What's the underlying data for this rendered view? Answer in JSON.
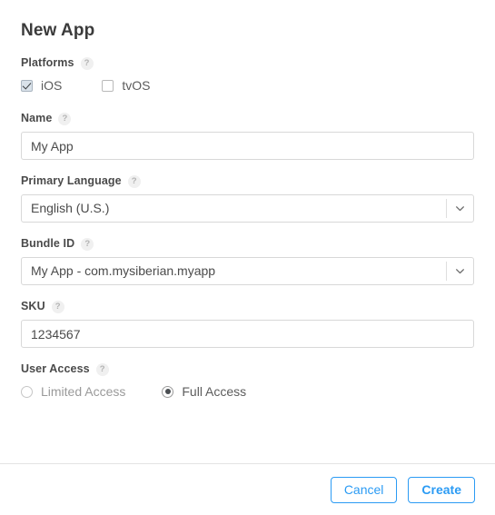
{
  "dialog": {
    "title": "New App"
  },
  "fields": {
    "platforms": {
      "label": "Platforms",
      "help": "?",
      "options": [
        {
          "label": "iOS",
          "checked": true
        },
        {
          "label": "tvOS",
          "checked": false
        }
      ]
    },
    "name": {
      "label": "Name",
      "help": "?",
      "value": "My App",
      "placeholder": "Name"
    },
    "primary_language": {
      "label": "Primary Language",
      "help": "?",
      "value": "English (U.S.)",
      "icon": "chevron-down-icon"
    },
    "bundle_id": {
      "label": "Bundle ID",
      "help": "?",
      "value": "My App - com.mysiberian.myapp",
      "icon": "chevron-down-icon"
    },
    "sku": {
      "label": "SKU",
      "help": "?",
      "value": "1234567",
      "placeholder": "SKU"
    },
    "user_access": {
      "label": "User Access",
      "help": "?",
      "options": [
        {
          "label": "Limited Access",
          "selected": false
        },
        {
          "label": "Full Access",
          "selected": true
        }
      ]
    }
  },
  "footer": {
    "cancel_label": "Cancel",
    "create_label": "Create"
  },
  "colors": {
    "accent": "#2b9bf4",
    "label": "#4a4a4a",
    "text": "#4b4b4b",
    "border": "#d8d8d8",
    "checkbox_fill": "#d9e2ea",
    "help_bg": "#f0f0f0"
  }
}
